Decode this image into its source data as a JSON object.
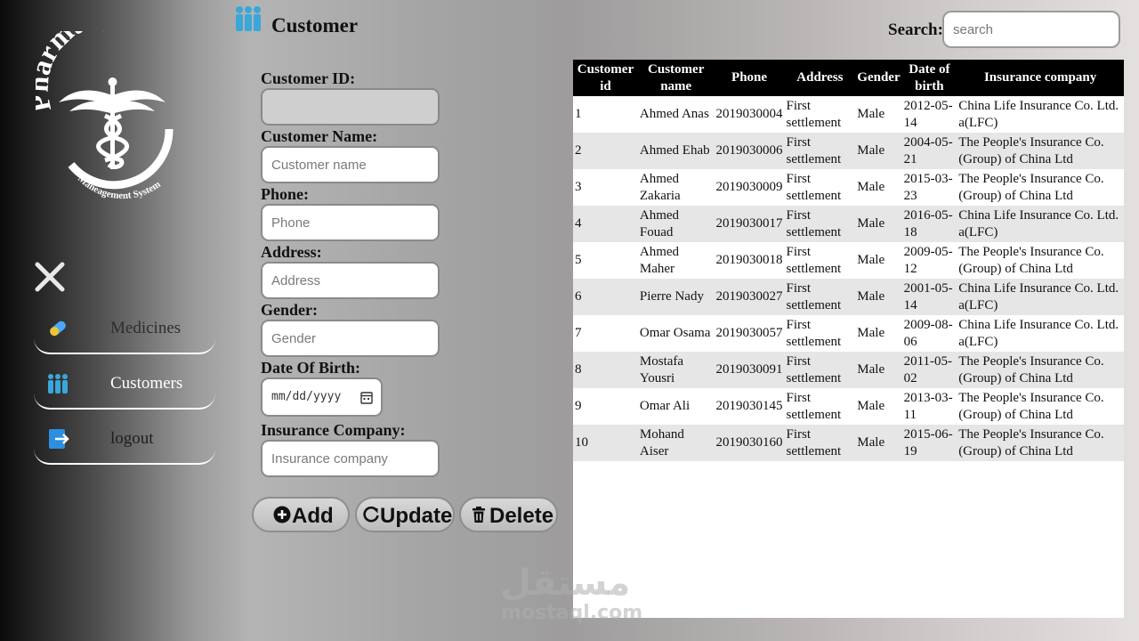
{
  "sidebar": {
    "logo": {
      "top_text": "Pharmacy",
      "bottom_text": "Maneagement System"
    },
    "items": [
      {
        "label": "Medicines",
        "icon": "pill-icon"
      },
      {
        "label": "Customers",
        "icon": "people-icon"
      },
      {
        "label": "logout",
        "icon": "logout-icon"
      }
    ]
  },
  "header": {
    "title": "Customer",
    "icon": "people-icon"
  },
  "search": {
    "label": "Search:",
    "placeholder": "search"
  },
  "form": {
    "customer_id": {
      "label": "Customer ID:",
      "placeholder": ""
    },
    "customer_name": {
      "label": "Customer Name:",
      "placeholder": "Customer name"
    },
    "phone": {
      "label": "Phone:",
      "placeholder": "Phone"
    },
    "address": {
      "label": "Address:",
      "placeholder": "Address"
    },
    "gender": {
      "label": "Gender:",
      "placeholder": "Gender"
    },
    "dob": {
      "label": "Date Of Birth:",
      "placeholder": "mm/dd/yyyy"
    },
    "insurance": {
      "label": "Insurance Company:",
      "placeholder": "Insurance company"
    }
  },
  "buttons": {
    "add": "Add",
    "update": "Update",
    "delete": "Delete"
  },
  "table": {
    "headers": [
      "Customer id",
      "Customer name",
      "Phone",
      "Address",
      "Gender",
      "Date of birth",
      "Insurance company"
    ],
    "rows": [
      [
        "1",
        "Ahmed Anas",
        "2019030004",
        "First settlement",
        "Male",
        "2012-05-14",
        "China Life Insurance Co. Ltd. a(LFC)"
      ],
      [
        "2",
        "Ahmed Ehab",
        "2019030006",
        "First settlement",
        "Male",
        "2004-05-21",
        "The People's Insurance Co. (Group) of China Ltd"
      ],
      [
        "3",
        "Ahmed Zakaria",
        "2019030009",
        "First settlement",
        "Male",
        "2015-03-23",
        "The People's Insurance Co. (Group) of China Ltd"
      ],
      [
        "4",
        "Ahmed Fouad",
        "2019030017",
        "First settlement",
        "Male",
        "2016-05-18",
        "China Life Insurance Co. Ltd. a(LFC)"
      ],
      [
        "5",
        "Ahmed Maher",
        "2019030018",
        "First settlement",
        "Male",
        "2009-05-12",
        "The People's Insurance Co. (Group) of China Ltd"
      ],
      [
        "6",
        "Pierre Nady",
        "2019030027",
        "First settlement",
        "Male",
        "2001-05-14",
        "China Life Insurance Co. Ltd. a(LFC)"
      ],
      [
        "7",
        "Omar Osama",
        "2019030057",
        "First settlement",
        "Male",
        "2009-08-06",
        "China Life Insurance Co. Ltd. a(LFC)"
      ],
      [
        "8",
        "Mostafa Yousri",
        "2019030091",
        "First settlement",
        "Male",
        "2011-05-02",
        "The People's Insurance Co. (Group) of China Ltd"
      ],
      [
        "9",
        "Omar Ali",
        "2019030145",
        "First settlement",
        "Male",
        "2013-03-11",
        "The People's Insurance Co. (Group) of China Ltd"
      ],
      [
        "10",
        "Mohand Aiser",
        "2019030160",
        "First settlement",
        "Male",
        "2015-06-19",
        "The People's Insurance Co. (Group) of China Ltd"
      ]
    ]
  },
  "watermark": {
    "arabic": "مستقل",
    "latin": "mostaql.com"
  }
}
